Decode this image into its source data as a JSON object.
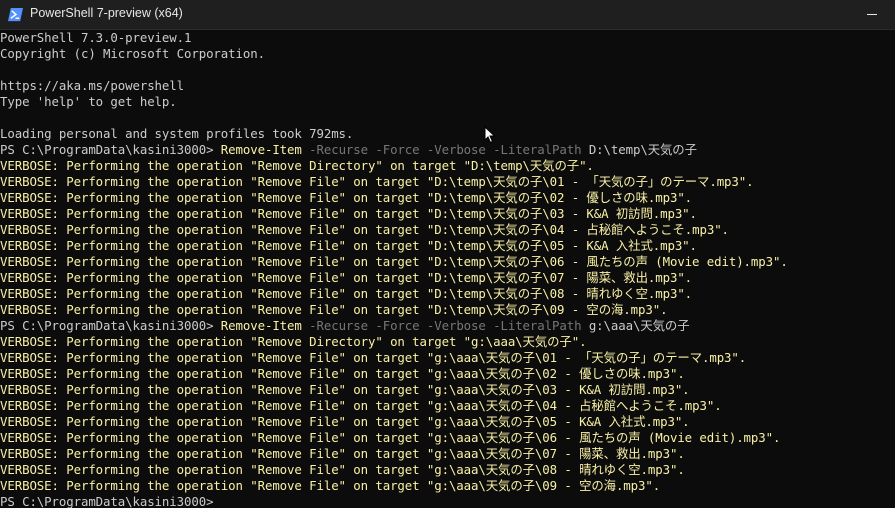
{
  "window": {
    "title": "PowerShell 7-preview (x64)"
  },
  "header_lines": [
    "PowerShell 7.3.0-preview.1",
    "Copyright (c) Microsoft Corporation.",
    "",
    "https://aka.ms/powershell",
    "Type 'help' to get help.",
    "",
    "Loading personal and system profiles took 792ms."
  ],
  "commands": [
    {
      "prompt": "PS C:\\ProgramData\\kasini3000> ",
      "cmdlet": "Remove-Item",
      "params": " -Recurse -Force -Verbose -LiteralPath ",
      "target": "D:\\temp\\天気の子",
      "output": [
        "VERBOSE: Performing the operation \"Remove Directory\" on target \"D:\\temp\\天気の子\".",
        "VERBOSE: Performing the operation \"Remove File\" on target \"D:\\temp\\天気の子\\01 - 「天気の子」のテーマ.mp3\".",
        "VERBOSE: Performing the operation \"Remove File\" on target \"D:\\temp\\天気の子\\02 - 優しさの味.mp3\".",
        "VERBOSE: Performing the operation \"Remove File\" on target \"D:\\temp\\天気の子\\03 - K&A 初訪問.mp3\".",
        "VERBOSE: Performing the operation \"Remove File\" on target \"D:\\temp\\天気の子\\04 - 占秘館へようこそ.mp3\".",
        "VERBOSE: Performing the operation \"Remove File\" on target \"D:\\temp\\天気の子\\05 - K&A 入社式.mp3\".",
        "VERBOSE: Performing the operation \"Remove File\" on target \"D:\\temp\\天気の子\\06 - 風たちの声 (Movie edit).mp3\".",
        "VERBOSE: Performing the operation \"Remove File\" on target \"D:\\temp\\天気の子\\07 - 陽菜、救出.mp3\".",
        "VERBOSE: Performing the operation \"Remove File\" on target \"D:\\temp\\天気の子\\08 - 晴れゆく空.mp3\".",
        "VERBOSE: Performing the operation \"Remove File\" on target \"D:\\temp\\天気の子\\09 - 空の海.mp3\"."
      ]
    },
    {
      "prompt": "PS C:\\ProgramData\\kasini3000> ",
      "cmdlet": "Remove-Item",
      "params": " -Recurse -Force -Verbose -LiteralPath ",
      "target": "g:\\aaa\\天気の子",
      "output": [
        "VERBOSE: Performing the operation \"Remove Directory\" on target \"g:\\aaa\\天気の子\".",
        "VERBOSE: Performing the operation \"Remove File\" on target \"g:\\aaa\\天気の子\\01 - 「天気の子」のテーマ.mp3\".",
        "VERBOSE: Performing the operation \"Remove File\" on target \"g:\\aaa\\天気の子\\02 - 優しさの味.mp3\".",
        "VERBOSE: Performing the operation \"Remove File\" on target \"g:\\aaa\\天気の子\\03 - K&A 初訪問.mp3\".",
        "VERBOSE: Performing the operation \"Remove File\" on target \"g:\\aaa\\天気の子\\04 - 占秘館へようこそ.mp3\".",
        "VERBOSE: Performing the operation \"Remove File\" on target \"g:\\aaa\\天気の子\\05 - K&A 入社式.mp3\".",
        "VERBOSE: Performing the operation \"Remove File\" on target \"g:\\aaa\\天気の子\\06 - 風たちの声 (Movie edit).mp3\".",
        "VERBOSE: Performing the operation \"Remove File\" on target \"g:\\aaa\\天気の子\\07 - 陽菜、救出.mp3\".",
        "VERBOSE: Performing the operation \"Remove File\" on target \"g:\\aaa\\天気の子\\08 - 晴れゆく空.mp3\".",
        "VERBOSE: Performing the operation \"Remove File\" on target \"g:\\aaa\\天気の子\\09 - 空の海.mp3\"."
      ]
    }
  ],
  "final_prompt": "PS C:\\ProgramData\\kasini3000>",
  "colors": {
    "background": "#0c0c0c",
    "foreground": "#cccccc",
    "verbose": "#f9f1a5",
    "parameter": "#767676",
    "titlebar": "#1f1f1f"
  },
  "icons": {
    "app": "powershell-icon",
    "minimize": "minimize-icon",
    "pointer": "mouse-pointer-icon"
  }
}
